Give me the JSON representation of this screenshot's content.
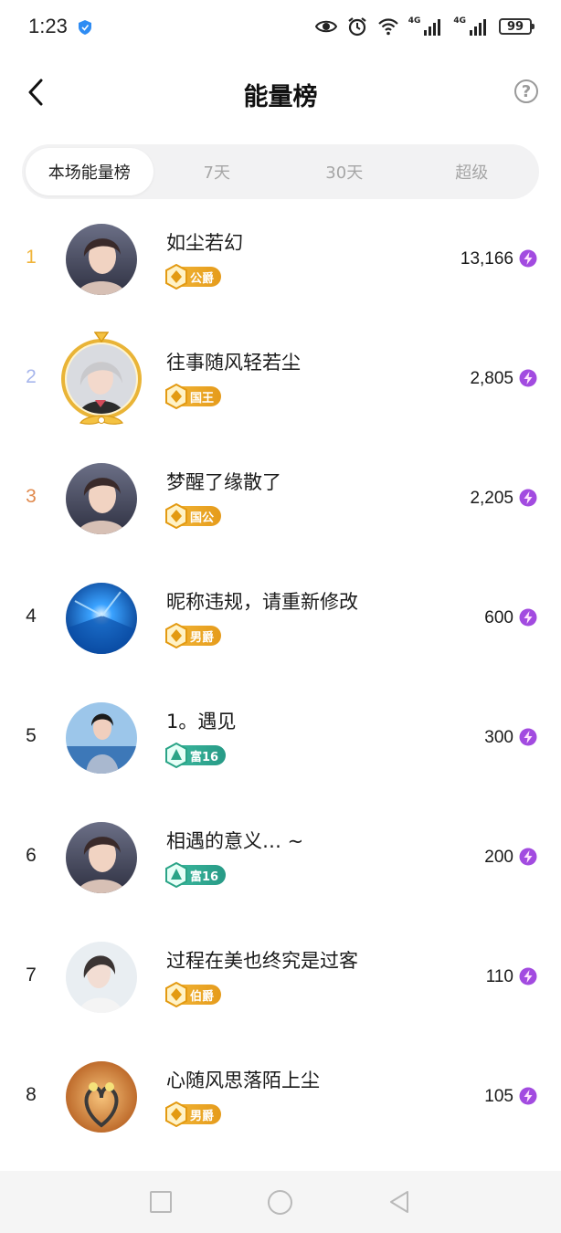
{
  "status_bar": {
    "time": "1:23",
    "network_left": "4G",
    "network_right": "4G",
    "battery": "99"
  },
  "header": {
    "title": "能量榜",
    "help_symbol": "?"
  },
  "tabs": [
    {
      "label": "本场能量榜",
      "active": true
    },
    {
      "label": "7天",
      "active": false
    },
    {
      "label": "30天",
      "active": false
    },
    {
      "label": "超级",
      "active": false
    }
  ],
  "rows": [
    {
      "rank": "1",
      "rank_color": "#f0b43a",
      "name": "如尘若幻",
      "badge": "公爵",
      "badge_type": "gold",
      "score": "13,166",
      "avatar": "woman-portrait"
    },
    {
      "rank": "2",
      "rank_color": "#a7b6ec",
      "name": "往事随风轻若尘",
      "badge": "国王",
      "badge_type": "gold",
      "score": "2,805",
      "avatar": "woman-portrait-framed"
    },
    {
      "rank": "3",
      "rank_color": "#e08a4e",
      "name": "梦醒了缘散了",
      "badge": "国公",
      "badge_type": "gold",
      "score": "2,205",
      "avatar": "woman-portrait"
    },
    {
      "rank": "4",
      "rank_color": "#222222",
      "name": "昵称违规，请重新修改",
      "badge": "男爵",
      "badge_type": "gold",
      "score": "600",
      "avatar": "blue-abstract"
    },
    {
      "rank": "5",
      "rank_color": "#222222",
      "name": "1。遇见",
      "badge": "富16",
      "badge_type": "teal",
      "score": "300",
      "avatar": "woman-seaside"
    },
    {
      "rank": "6",
      "rank_color": "#222222",
      "name": "相遇的意义… ~",
      "badge": "富16",
      "badge_type": "teal",
      "score": "200",
      "avatar": "woman-portrait"
    },
    {
      "rank": "7",
      "rank_color": "#222222",
      "name": "过程在美也终究是过客",
      "badge": "伯爵",
      "badge_type": "gold",
      "score": "110",
      "avatar": "woman-light"
    },
    {
      "rank": "8",
      "rank_color": "#222222",
      "name": "心随风思落陌上尘",
      "badge": "男爵",
      "badge_type": "gold",
      "score": "105",
      "avatar": "cranes-heart"
    }
  ],
  "colors": {
    "accent_gold": "#e9a826",
    "accent_teal": "#2fa88f",
    "energy_purple": "#9b3fd6"
  }
}
